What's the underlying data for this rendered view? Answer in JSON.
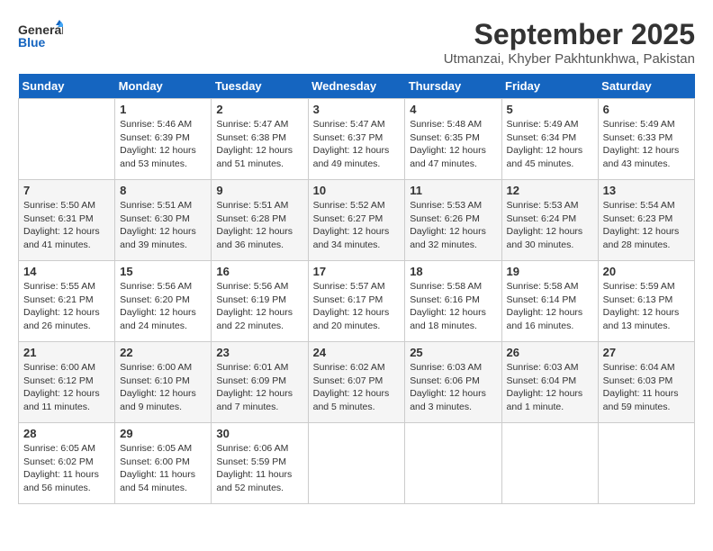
{
  "header": {
    "logo_general": "General",
    "logo_blue": "Blue",
    "month_title": "September 2025",
    "subtitle": "Utmanzai, Khyber Pakhtunkhwa, Pakistan"
  },
  "days_of_week": [
    "Sunday",
    "Monday",
    "Tuesday",
    "Wednesday",
    "Thursday",
    "Friday",
    "Saturday"
  ],
  "weeks": [
    [
      {
        "day": "",
        "info": ""
      },
      {
        "day": "1",
        "info": "Sunrise: 5:46 AM\nSunset: 6:39 PM\nDaylight: 12 hours\nand 53 minutes."
      },
      {
        "day": "2",
        "info": "Sunrise: 5:47 AM\nSunset: 6:38 PM\nDaylight: 12 hours\nand 51 minutes."
      },
      {
        "day": "3",
        "info": "Sunrise: 5:47 AM\nSunset: 6:37 PM\nDaylight: 12 hours\nand 49 minutes."
      },
      {
        "day": "4",
        "info": "Sunrise: 5:48 AM\nSunset: 6:35 PM\nDaylight: 12 hours\nand 47 minutes."
      },
      {
        "day": "5",
        "info": "Sunrise: 5:49 AM\nSunset: 6:34 PM\nDaylight: 12 hours\nand 45 minutes."
      },
      {
        "day": "6",
        "info": "Sunrise: 5:49 AM\nSunset: 6:33 PM\nDaylight: 12 hours\nand 43 minutes."
      }
    ],
    [
      {
        "day": "7",
        "info": "Sunrise: 5:50 AM\nSunset: 6:31 PM\nDaylight: 12 hours\nand 41 minutes."
      },
      {
        "day": "8",
        "info": "Sunrise: 5:51 AM\nSunset: 6:30 PM\nDaylight: 12 hours\nand 39 minutes."
      },
      {
        "day": "9",
        "info": "Sunrise: 5:51 AM\nSunset: 6:28 PM\nDaylight: 12 hours\nand 36 minutes."
      },
      {
        "day": "10",
        "info": "Sunrise: 5:52 AM\nSunset: 6:27 PM\nDaylight: 12 hours\nand 34 minutes."
      },
      {
        "day": "11",
        "info": "Sunrise: 5:53 AM\nSunset: 6:26 PM\nDaylight: 12 hours\nand 32 minutes."
      },
      {
        "day": "12",
        "info": "Sunrise: 5:53 AM\nSunset: 6:24 PM\nDaylight: 12 hours\nand 30 minutes."
      },
      {
        "day": "13",
        "info": "Sunrise: 5:54 AM\nSunset: 6:23 PM\nDaylight: 12 hours\nand 28 minutes."
      }
    ],
    [
      {
        "day": "14",
        "info": "Sunrise: 5:55 AM\nSunset: 6:21 PM\nDaylight: 12 hours\nand 26 minutes."
      },
      {
        "day": "15",
        "info": "Sunrise: 5:56 AM\nSunset: 6:20 PM\nDaylight: 12 hours\nand 24 minutes."
      },
      {
        "day": "16",
        "info": "Sunrise: 5:56 AM\nSunset: 6:19 PM\nDaylight: 12 hours\nand 22 minutes."
      },
      {
        "day": "17",
        "info": "Sunrise: 5:57 AM\nSunset: 6:17 PM\nDaylight: 12 hours\nand 20 minutes."
      },
      {
        "day": "18",
        "info": "Sunrise: 5:58 AM\nSunset: 6:16 PM\nDaylight: 12 hours\nand 18 minutes."
      },
      {
        "day": "19",
        "info": "Sunrise: 5:58 AM\nSunset: 6:14 PM\nDaylight: 12 hours\nand 16 minutes."
      },
      {
        "day": "20",
        "info": "Sunrise: 5:59 AM\nSunset: 6:13 PM\nDaylight: 12 hours\nand 13 minutes."
      }
    ],
    [
      {
        "day": "21",
        "info": "Sunrise: 6:00 AM\nSunset: 6:12 PM\nDaylight: 12 hours\nand 11 minutes."
      },
      {
        "day": "22",
        "info": "Sunrise: 6:00 AM\nSunset: 6:10 PM\nDaylight: 12 hours\nand 9 minutes."
      },
      {
        "day": "23",
        "info": "Sunrise: 6:01 AM\nSunset: 6:09 PM\nDaylight: 12 hours\nand 7 minutes."
      },
      {
        "day": "24",
        "info": "Sunrise: 6:02 AM\nSunset: 6:07 PM\nDaylight: 12 hours\nand 5 minutes."
      },
      {
        "day": "25",
        "info": "Sunrise: 6:03 AM\nSunset: 6:06 PM\nDaylight: 12 hours\nand 3 minutes."
      },
      {
        "day": "26",
        "info": "Sunrise: 6:03 AM\nSunset: 6:04 PM\nDaylight: 12 hours\nand 1 minute."
      },
      {
        "day": "27",
        "info": "Sunrise: 6:04 AM\nSunset: 6:03 PM\nDaylight: 11 hours\nand 59 minutes."
      }
    ],
    [
      {
        "day": "28",
        "info": "Sunrise: 6:05 AM\nSunset: 6:02 PM\nDaylight: 11 hours\nand 56 minutes."
      },
      {
        "day": "29",
        "info": "Sunrise: 6:05 AM\nSunset: 6:00 PM\nDaylight: 11 hours\nand 54 minutes."
      },
      {
        "day": "30",
        "info": "Sunrise: 6:06 AM\nSunset: 5:59 PM\nDaylight: 11 hours\nand 52 minutes."
      },
      {
        "day": "",
        "info": ""
      },
      {
        "day": "",
        "info": ""
      },
      {
        "day": "",
        "info": ""
      },
      {
        "day": "",
        "info": ""
      }
    ]
  ]
}
